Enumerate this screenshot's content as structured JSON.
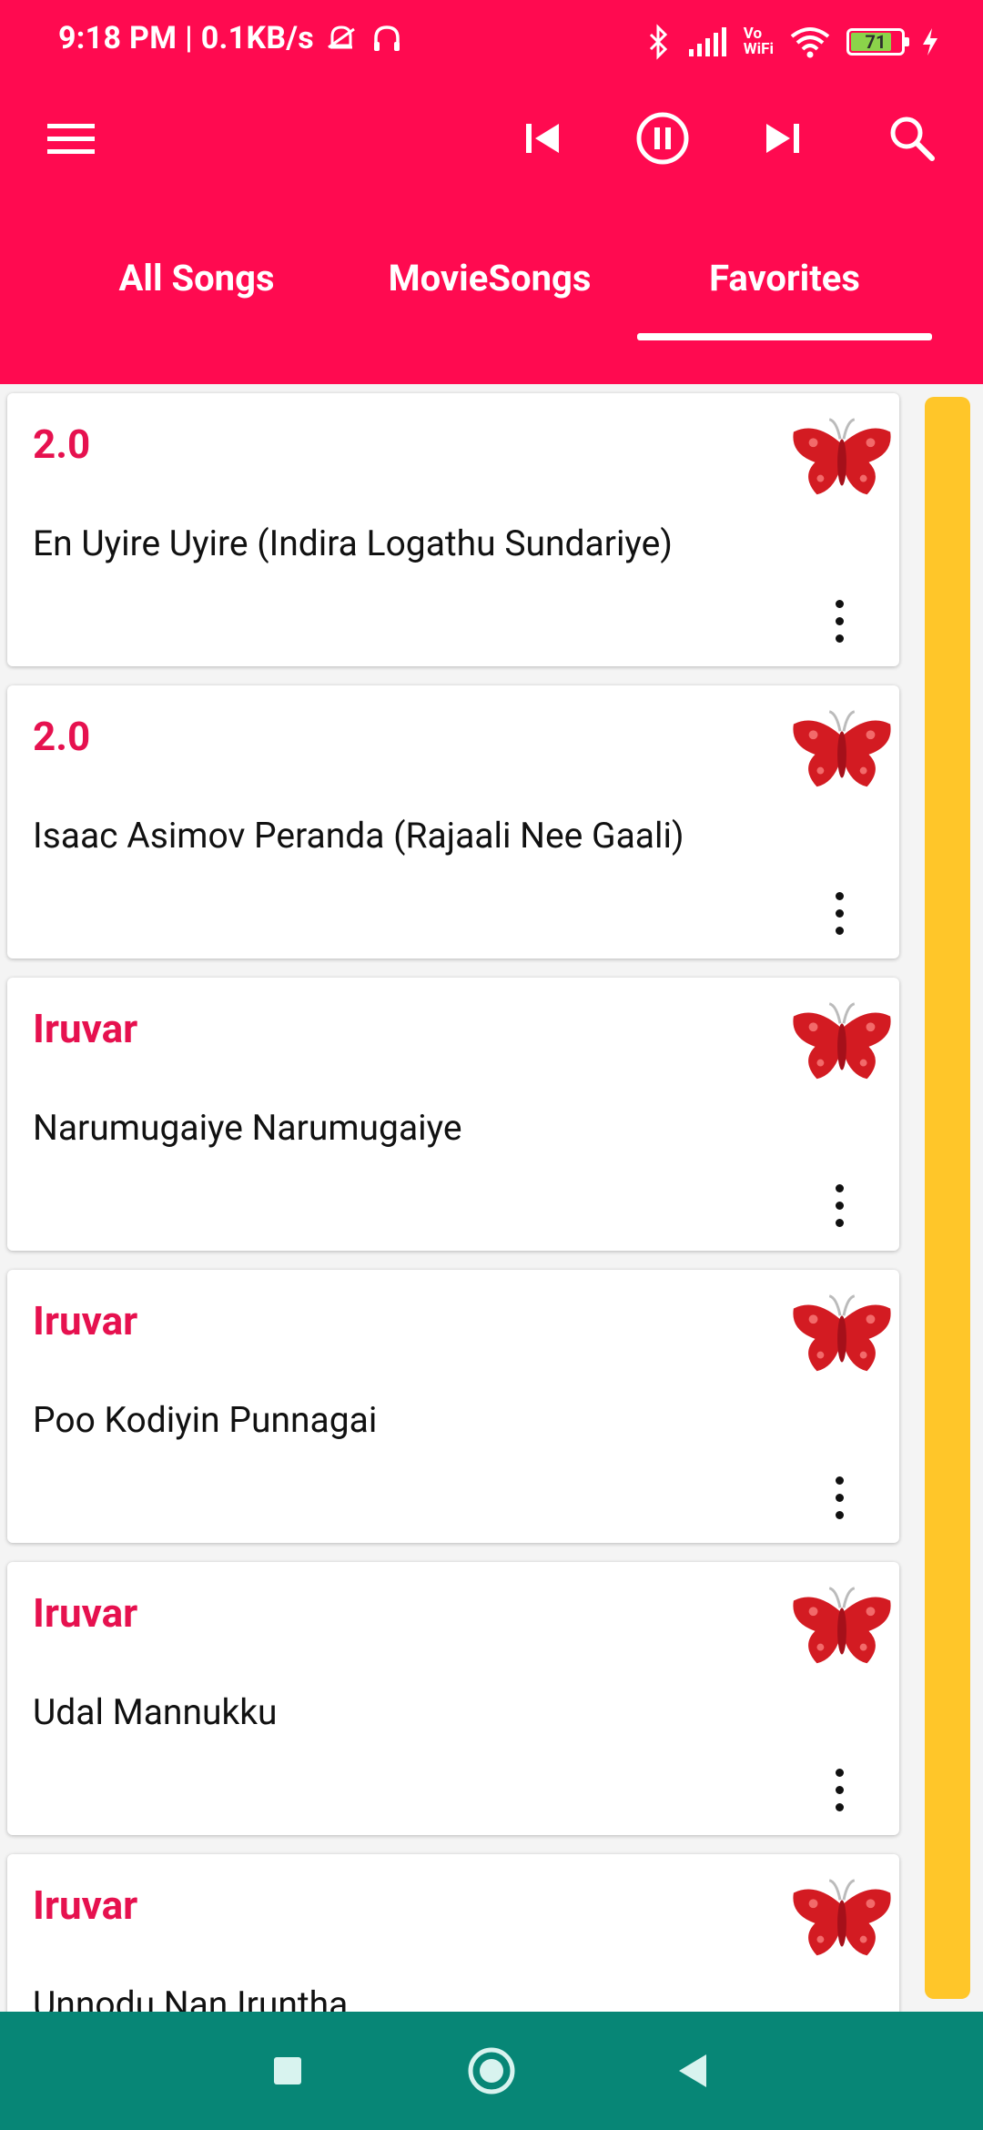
{
  "status_bar": {
    "time_text": "9:18 PM | 0.1KB/s",
    "battery": "71",
    "wifi_label_top": "Vo",
    "wifi_label_bottom": "WiFi",
    "icons": [
      "muted-bell-icon",
      "headphones-icon",
      "bluetooth-icon",
      "signal-icon",
      "vowifi-icon",
      "wifi-icon",
      "battery-icon",
      "charging-icon"
    ]
  },
  "toolbar": {
    "icons": [
      "menu-icon",
      "skip-previous-icon",
      "pause-icon",
      "skip-next-icon",
      "search-icon"
    ]
  },
  "tabs": [
    {
      "label": "All Songs"
    },
    {
      "label": "MovieSongs"
    },
    {
      "label": "Favorites",
      "selected": true
    }
  ],
  "songs": [
    {
      "movie": "2.0",
      "title": "En Uyire Uyire (Indira Logathu Sundariye)"
    },
    {
      "movie": "2.0",
      "title": "Isaac Asimov Peranda (Rajaali Nee Gaali)"
    },
    {
      "movie": "Iruvar",
      "title": "Narumugaiye Narumugaiye"
    },
    {
      "movie": "Iruvar",
      "title": "Poo Kodiyin Punnagai"
    },
    {
      "movie": "Iruvar",
      "title": "Udal Mannukku"
    },
    {
      "movie": "Iruvar",
      "title": "Unnodu Nan Iruntha"
    }
  ],
  "colors": {
    "primary": "#ff0a50",
    "accent_text": "#e6114f",
    "scrollbar": "#ffc629",
    "navbar": "#078676"
  },
  "nav": {
    "icons": [
      "recents-square-icon",
      "home-circle-icon",
      "back-triangle-icon"
    ]
  }
}
